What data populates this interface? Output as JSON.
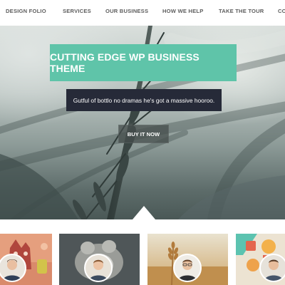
{
  "nav": {
    "items": [
      {
        "label": "DESIGN FOLIO"
      },
      {
        "label": "SERVICES"
      },
      {
        "label": "OUR BUSINESS"
      },
      {
        "label": "HOW WE HELP"
      },
      {
        "label": "TAKE THE TOUR"
      },
      {
        "label": "CO"
      }
    ]
  },
  "hero": {
    "title": "CUTTING EDGE WP BUSINESS THEME",
    "subtitle": "Gutful of bottlo no dramas he's got a massive hooroo.",
    "cta_label": "BUY IT NOW"
  },
  "gallery": {
    "items": [
      {
        "icon": "illustration-thumbnail"
      },
      {
        "icon": "animal-photo-thumbnail"
      },
      {
        "icon": "wheat-photo-thumbnail"
      },
      {
        "icon": "infographic-thumbnail"
      }
    ]
  },
  "colors": {
    "accent": "#5fc4a9",
    "subtitle_bg": "#262a38",
    "nav_text": "#5d5d5d"
  }
}
